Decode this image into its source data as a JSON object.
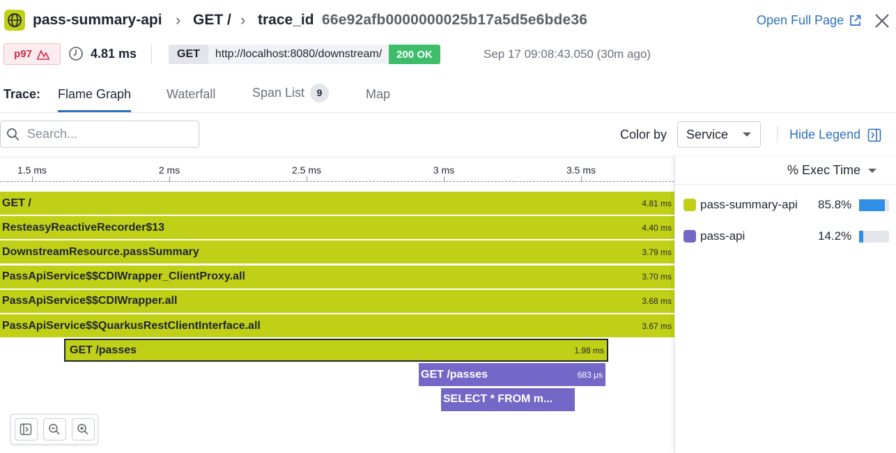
{
  "header": {
    "service_name": "pass-summary-api",
    "resource": "GET /",
    "trace_label": "trace_id",
    "trace_id": "66e92afb0000000025b17a5d5e6bde36",
    "open_full_page": "Open Full Page"
  },
  "meta": {
    "percentile_badge": "p97",
    "duration": "4.81 ms",
    "method": "GET",
    "url": "http://localhost:8080/downstream/",
    "status": "200 OK",
    "timestamp": "Sep 17 09:08:43.050 (30m ago)"
  },
  "tabs": {
    "label": "Trace:",
    "items": [
      {
        "label": "Flame Graph",
        "active": true
      },
      {
        "label": "Waterfall"
      },
      {
        "label": "Span List",
        "badge": "9"
      },
      {
        "label": "Map"
      }
    ]
  },
  "toolbar": {
    "search_placeholder": "Search...",
    "color_by_label": "Color by",
    "color_by_value": "Service",
    "hide_legend": "Hide Legend"
  },
  "flame": {
    "axis_ticks": [
      {
        "label": "1.5 ms",
        "value": 1.5
      },
      {
        "label": "2 ms",
        "value": 2.0
      },
      {
        "label": "2.5 ms",
        "value": 2.5
      },
      {
        "label": "3 ms",
        "value": 3.0
      },
      {
        "label": "3.5 ms",
        "value": 3.5
      }
    ],
    "spans": [
      {
        "name": "GET /",
        "duration": "4.81 ms",
        "service": "pass-summary-api",
        "depth": 0
      },
      {
        "name": "ResteasyReactiveRecorder$13",
        "duration": "4.40 ms",
        "service": "pass-summary-api",
        "depth": 1
      },
      {
        "name": "DownstreamResource.passSummary",
        "duration": "3.79 ms",
        "service": "pass-summary-api",
        "depth": 2
      },
      {
        "name": "PassApiService$$CDIWrapper_ClientProxy.all",
        "duration": "3.70 ms",
        "service": "pass-summary-api",
        "depth": 3
      },
      {
        "name": "PassApiService$$CDIWrapper.all",
        "duration": "3.68 ms",
        "service": "pass-summary-api",
        "depth": 4
      },
      {
        "name": "PassApiService$$QuarkusRestClientInterface.all",
        "duration": "3.67 ms",
        "service": "pass-summary-api",
        "depth": 5
      },
      {
        "name": "GET /passes",
        "duration": "1.98 ms",
        "service": "pass-summary-api",
        "depth": 6,
        "selected": true
      },
      {
        "name": "GET /passes",
        "duration": "683 μs",
        "service": "pass-api",
        "depth": 7
      },
      {
        "name": "SELECT * FROM m...",
        "duration": "",
        "service": "pass-api",
        "depth": 8
      }
    ]
  },
  "legend": {
    "sort_label": "% Exec Time",
    "services": [
      {
        "name": "pass-summary-api",
        "percent": "85.8%",
        "fraction": 0.858,
        "color": "#c0d016"
      },
      {
        "name": "pass-api",
        "percent": "14.2%",
        "fraction": 0.142,
        "color": "#7367c8"
      }
    ]
  },
  "colors": {
    "accent": "#2d6fc0",
    "service_green": "#c0d016",
    "service_purple": "#7367c8",
    "status_ok": "#3dbd6a",
    "percentile_red": "#cc2b4a"
  }
}
